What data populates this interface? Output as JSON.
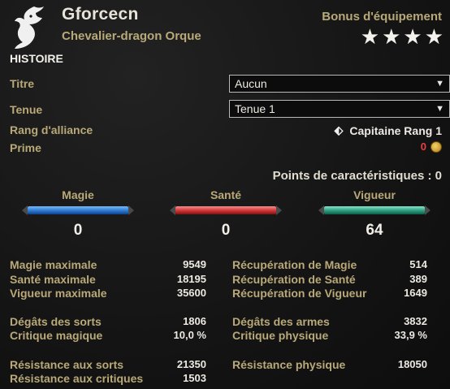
{
  "header": {
    "character_name": "Gforcecn",
    "character_subtitle": "Chevalier-dragon Orque",
    "bonus_title": "Bonus d'équipement",
    "bonus_stars": 4
  },
  "history": {
    "section_title": "HISTOIRE",
    "title_label": "Titre",
    "title_value": "Aucun",
    "outfit_label": "Tenue",
    "outfit_value": "Tenue 1",
    "alliance_rank_label": "Rang d'alliance",
    "alliance_rank_value": "Capitaine Rang 1",
    "bounty_label": "Prime",
    "bounty_value": "0"
  },
  "attributes": {
    "points_label": "Points de caractéristiques : 0",
    "items": [
      {
        "name": "Magie",
        "value": "0",
        "color": "#2f7fd6"
      },
      {
        "name": "Santé",
        "value": "0",
        "color": "#d63a3a"
      },
      {
        "name": "Vigueur",
        "value": "64",
        "color": "#2fa386"
      }
    ]
  },
  "stats": {
    "left": [
      {
        "label": "Magie maximale",
        "value": "9549"
      },
      {
        "label": "Santé maximale",
        "value": "18195"
      },
      {
        "label": "Vigueur maximale",
        "value": "35600"
      },
      {
        "label": "Dégâts des sorts",
        "value": "1806"
      },
      {
        "label": "Critique magique",
        "value": "10,0 %"
      },
      {
        "label": "Résistance aux sorts",
        "value": "21350"
      },
      {
        "label": "Résistance aux critiques",
        "value": "1503"
      }
    ],
    "right": [
      {
        "label": "Récupération de Magie",
        "value": "514"
      },
      {
        "label": "Récupération de Santé",
        "value": "389"
      },
      {
        "label": "Récupération de Vigueur",
        "value": "1649"
      },
      {
        "label": "Dégâts des armes",
        "value": "3832"
      },
      {
        "label": "Critique physique",
        "value": "33,9 %"
      },
      {
        "label": "Résistance physique",
        "value": "18050"
      }
    ]
  }
}
